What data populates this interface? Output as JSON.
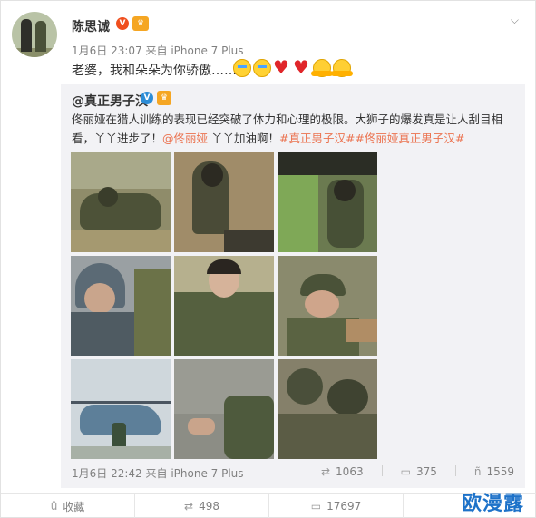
{
  "post": {
    "username": "陈思诚",
    "badge_v": "V",
    "meta_time": "1月6日 23:07",
    "meta_from": "来自",
    "meta_device": "iPhone 7 Plus",
    "text": "老婆，我和朵朵为你骄傲……",
    "emojis": [
      "cry",
      "cry",
      "heart",
      "heart",
      "hug",
      "hug"
    ],
    "menu_icon": "chevron-down-icon"
  },
  "repost": {
    "user": "@真正男子汉",
    "badge_v": "V",
    "body_plain": "佟丽娅在猎人训练的表现已经突破了体力和心理的极限。大狮子的爆发真是让人刮目相看，丫丫进步了！",
    "body_mention": "@佟丽娅",
    "body_mid": " 丫丫加油啊！",
    "body_tags": "#真正男子汉##佟丽娅真正男子汉#",
    "photos": [
      "photo-crawling-soldiers",
      "photo-muddy-soldier",
      "photo-climbing-truck",
      "photo-helmet-portrait",
      "photo-group-camouflage",
      "photo-smiling-soldier",
      "photo-helicopter",
      "photo-soldier-wall",
      "photo-soldiers-trench"
    ],
    "footer_time": "1月6日 22:42",
    "footer_from": "来自",
    "footer_device": "iPhone 7 Plus",
    "stats": {
      "reposts": "1063",
      "comments": "375",
      "likes": "1559"
    }
  },
  "actions": {
    "favorite_label": "收藏",
    "repost_count": "498",
    "comment_count": "17697",
    "like_count": ""
  },
  "watermark": "欧漫露",
  "colors": {
    "link": "#eb7350",
    "meta": "#808080",
    "repost_bg": "#f2f2f5",
    "verified_orange": "#f04e1d",
    "verified_blue": "#2c8cd6",
    "watermark": "#1d72c9"
  }
}
